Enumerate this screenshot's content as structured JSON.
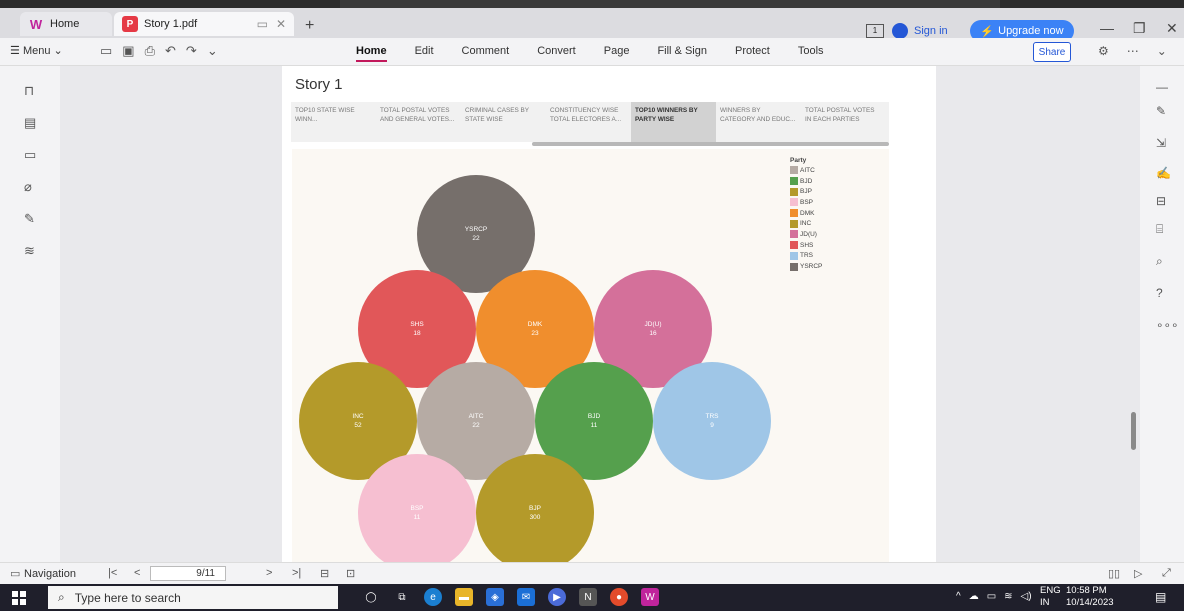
{
  "tabs": {
    "home_label": "Home",
    "doc_label": "Story 1.pdf",
    "new_tab": "+"
  },
  "header": {
    "sign_in": "Sign in",
    "upgrade": "Upgrade now"
  },
  "toolbar": {
    "menu_label": "Menu",
    "nav": [
      "Home",
      "Edit",
      "Comment",
      "Convert",
      "Page",
      "Fill & Sign",
      "Protect",
      "Tools"
    ],
    "share_label": "Share"
  },
  "document": {
    "story_title": "Story 1",
    "story_tabs": [
      "TOP10 STATE WISE WINN...",
      "TOTAL POSTAL VOTES AND GENERAL VOTES...",
      "CRIMINAL CASES BY STATE WISE",
      "CONSTITUENCY WISE TOTAL ELECTORES A...",
      "TOP10 WINNERS BY PARTY WISE",
      "WINNERS BY CATEGORY AND EDUC...",
      "TOTAL POSTAL VOTES IN EACH PARTIES"
    ],
    "active_story_tab": 4
  },
  "chart_data": {
    "type": "packed-bubble",
    "legend_title": "Party",
    "legend_position": "top-right",
    "legend": [
      "AITC",
      "BJD",
      "BJP",
      "BSP",
      "DMK",
      "INC",
      "JD(U)",
      "SHS",
      "TRS",
      "YSRCP"
    ],
    "colors": {
      "AITC": "#b6aba4",
      "BJD": "#55a04d",
      "BJP": "#b49a2a",
      "BSP": "#f6bfd1",
      "DMK": "#f08e2d",
      "INC": "#b49a2a",
      "JD(U)": "#d4709a",
      "SHS": "#e15759",
      "TRS": "#9fc6e7",
      "YSRCP": "#766f6b"
    },
    "bubbles": [
      {
        "party": "YSRCP",
        "value": "22"
      },
      {
        "party": "SHS",
        "value": "18"
      },
      {
        "party": "DMK",
        "value": "23"
      },
      {
        "party": "JD(U)",
        "value": "16"
      },
      {
        "party": "INC",
        "value": "52"
      },
      {
        "party": "AITC",
        "value": "22"
      },
      {
        "party": "BJD",
        "value": "11"
      },
      {
        "party": "TRS",
        "value": "9"
      },
      {
        "party": "BSP",
        "value": "11"
      },
      {
        "party": "BJP",
        "value": "300"
      }
    ]
  },
  "status": {
    "navigation_label": "Navigation",
    "page_indicator": "9/11"
  },
  "taskbar": {
    "search_placeholder": "Type here to search",
    "lang_top": "ENG",
    "lang_bottom": "IN",
    "time": "10:58 PM",
    "date": "10/14/2023"
  }
}
